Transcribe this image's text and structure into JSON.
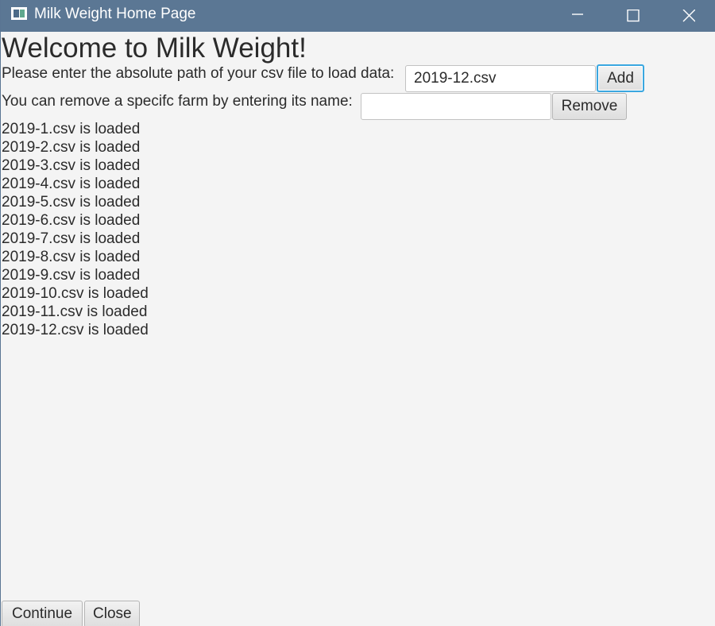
{
  "window": {
    "title": "Milk Weight Home Page",
    "controls": [
      "minimize-icon",
      "maximize-icon",
      "close-icon"
    ]
  },
  "main": {
    "heading": "Welcome to Milk Weight!",
    "load": {
      "label": "Please enter the absolute path of your csv file to load data:",
      "value": "2019-12.csv",
      "button_label": "Add"
    },
    "remove": {
      "label": "You can remove a specifc farm by entering its name:",
      "value": "",
      "button_label": "Remove"
    },
    "loaded_messages": [
      "2019-1.csv is loaded",
      "2019-2.csv is loaded",
      "2019-3.csv is loaded",
      "2019-4.csv is loaded",
      "2019-5.csv is loaded",
      "2019-6.csv is loaded",
      "2019-7.csv is loaded",
      "2019-8.csv is loaded",
      "2019-9.csv is loaded",
      "2019-10.csv is loaded",
      "2019-11.csv is loaded",
      "2019-12.csv is loaded"
    ]
  },
  "footer": {
    "continue_label": "Continue",
    "close_label": "Close"
  },
  "colors": {
    "titlebar": "#5b7794",
    "background": "#f4f4f4",
    "focus": "#3aa7e0"
  }
}
